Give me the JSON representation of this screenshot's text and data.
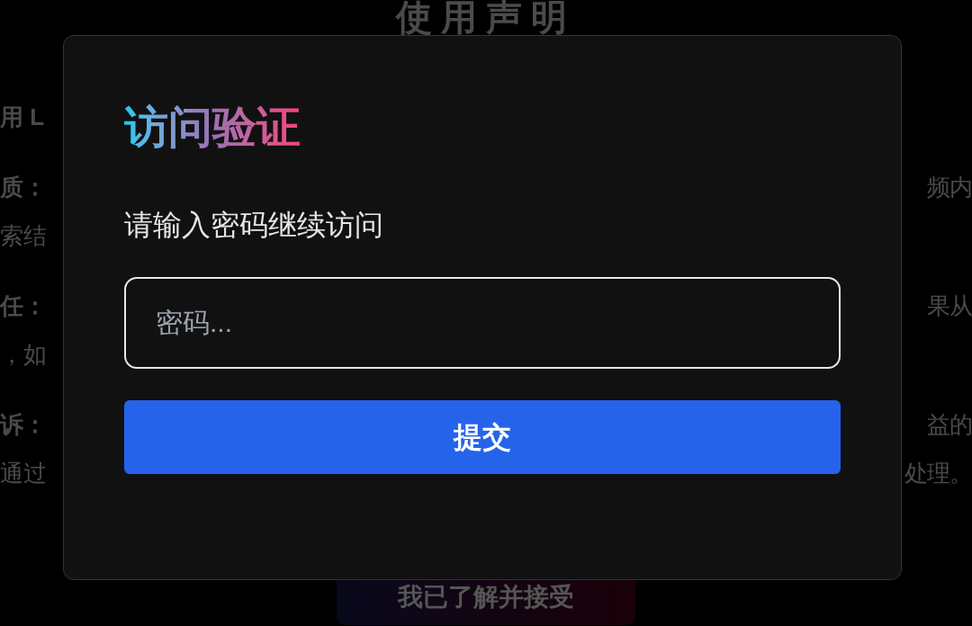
{
  "background_page": {
    "title": "使用声明",
    "paragraphs": [
      {
        "lines": [
          {
            "left": "用 L"
          }
        ]
      },
      {
        "lines": [
          {
            "left": "质：",
            "right": "频内"
          },
          {
            "left": "索结"
          }
        ]
      },
      {
        "lines": [
          {
            "left": "任：",
            "right": "果从"
          },
          {
            "left": "，如"
          }
        ]
      },
      {
        "lines": [
          {
            "left": "诉：",
            "right": "益的"
          },
          {
            "left": "通过",
            "right": "处理。"
          }
        ]
      }
    ],
    "accept_button": "我已了解并接受"
  },
  "dialog": {
    "title": "访问验证",
    "prompt": "请输入密码继续访问",
    "password_field": {
      "placeholder": "密码..."
    },
    "submit_button": "提交"
  }
}
